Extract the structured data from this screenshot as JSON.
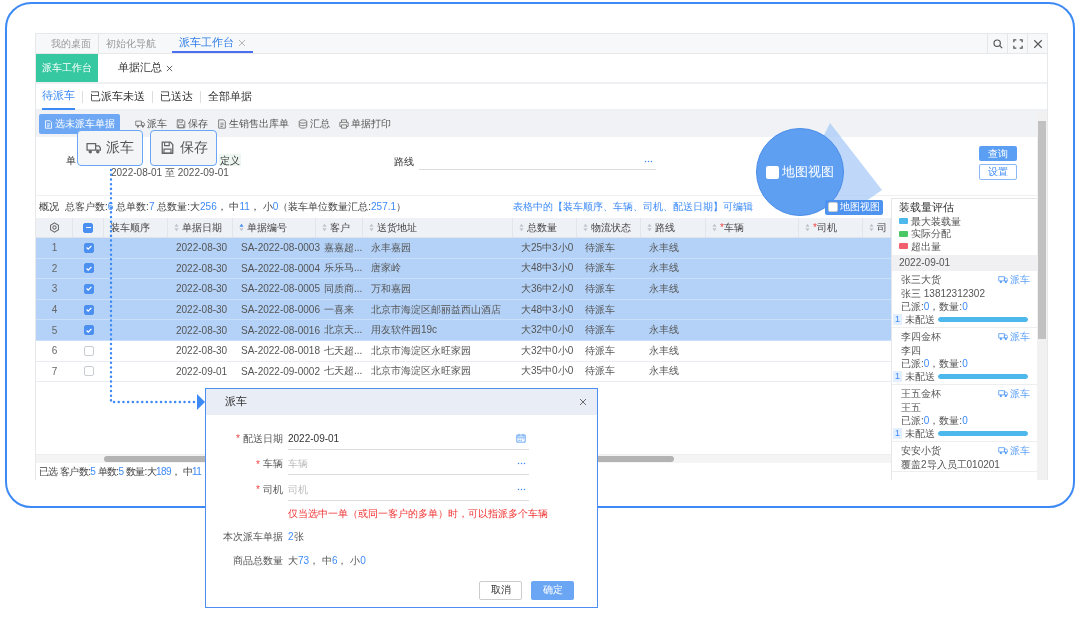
{
  "window": {
    "tabs": [
      {
        "label": "我的桌面",
        "selected": false,
        "closable": false
      },
      {
        "label": "初始化导航",
        "selected": false,
        "closable": false
      },
      {
        "label": "派车工作台",
        "selected": true,
        "closable": true
      }
    ]
  },
  "module_tabs": [
    {
      "label": "派车工作台",
      "selected": true,
      "closable": false
    },
    {
      "label": "单据汇总",
      "selected": false,
      "closable": true
    }
  ],
  "status_tabs": [
    {
      "label": "待派车",
      "selected": true
    },
    {
      "label": "已派车未送",
      "selected": false
    },
    {
      "label": "已送达",
      "selected": false
    },
    {
      "label": "全部单据",
      "selected": false
    }
  ],
  "toolbar": {
    "primary": "选未派车单据",
    "actions": [
      {
        "label": "派车",
        "kind": "truck"
      },
      {
        "label": "保存",
        "kind": "save"
      },
      {
        "label": "生销售出库单",
        "kind": "doc"
      },
      {
        "label": "汇总",
        "kind": "sum"
      },
      {
        "label": "单据打印",
        "kind": "print"
      }
    ]
  },
  "filters": {
    "date_label": "单",
    "range_options": [
      "定义"
    ],
    "date_range": "2022-08-01 至 2022-09-01",
    "route_label": "路线",
    "query": "查询",
    "settings": "设置"
  },
  "summary": {
    "title": "概况",
    "parts": [
      {
        "text": "总客户数:",
        "kind": "label"
      },
      {
        "text": "6",
        "kind": "number"
      },
      {
        "text": " 总单数:",
        "kind": "label"
      },
      {
        "text": "7",
        "kind": "number"
      },
      {
        "text": " 总数量:大",
        "kind": "label"
      },
      {
        "text": "256",
        "kind": "number"
      },
      {
        "text": "， 中",
        "kind": "label"
      },
      {
        "text": "11",
        "kind": "number"
      },
      {
        "text": "， 小",
        "kind": "label"
      },
      {
        "text": "0",
        "kind": "number"
      },
      {
        "text": "（装车单位数量汇总:",
        "kind": "label"
      },
      {
        "text": "257.1",
        "kind": "number"
      },
      {
        "text": "）",
        "kind": "label"
      }
    ]
  },
  "hint": "表格中的【装车顺序、车辆、司机、配送日期】可编辑",
  "map_view": {
    "label": "地图视图",
    "checked": false
  },
  "table": {
    "columns": [
      {
        "kind": "settings"
      },
      {
        "kind": "select",
        "indeterminate": true
      },
      {
        "kind": "data",
        "label": "装车顺序"
      },
      {
        "kind": "data",
        "label": "单据日期",
        "sorted": false
      },
      {
        "kind": "data",
        "label": "单据编号",
        "sorted": true
      },
      {
        "kind": "data",
        "label": "客户",
        "sorted": false
      },
      {
        "kind": "data",
        "label": "送货地址",
        "sorted": false
      },
      {
        "kind": "data",
        "label": "总数量",
        "sorted": false
      },
      {
        "kind": "data",
        "label": "物流状态",
        "sorted": false
      },
      {
        "kind": "data",
        "label": "路线",
        "sorted": false
      },
      {
        "kind": "data",
        "label": "车辆",
        "sorted": false,
        "marker": "*"
      },
      {
        "kind": "data",
        "label": "司机",
        "sorted": false,
        "marker": "*"
      },
      {
        "kind": "data",
        "label": "司",
        "sorted": false
      }
    ],
    "rows": [
      {
        "checked": true,
        "selected": true,
        "cells": [
          "1",
          "",
          "",
          "2022-08-30",
          "SA-2022-08-0003",
          "嘉嘉超...",
          "永丰嘉园",
          "大25中3小0",
          "待派车",
          "永丰线"
        ]
      },
      {
        "checked": true,
        "selected": true,
        "cells": [
          "2",
          "",
          "",
          "2022-08-30",
          "SA-2022-08-0004",
          "乐乐马...",
          "唐家岭",
          "大48中3小0",
          "待派车",
          "永丰线"
        ]
      },
      {
        "checked": true,
        "selected": true,
        "cells": [
          "3",
          "",
          "",
          "2022-08-30",
          "SA-2022-08-0005",
          "同质商...",
          "万和嘉园",
          "大36中2小0",
          "待派车",
          "永丰线"
        ]
      },
      {
        "checked": true,
        "selected": true,
        "cells": [
          "4",
          "",
          "",
          "2022-08-30",
          "SA-2022-08-0006",
          "一喜来",
          "北京市海淀区邮丽益西山酒店",
          "大48中3小0",
          "待派车",
          ""
        ]
      },
      {
        "checked": true,
        "selected": true,
        "cells": [
          "5",
          "",
          "",
          "2022-08-30",
          "SA-2022-08-0016",
          "北京天...",
          "用友软件园19c",
          "大32中0小0",
          "待派车",
          "永丰线"
        ]
      },
      {
        "checked": false,
        "selected": false,
        "cells": [
          "6",
          "",
          "",
          "2022-08-30",
          "SA-2022-08-0018",
          "七天超...",
          "北京市海淀区永旺家园",
          "大32中0小0",
          "待派车",
          "永丰线"
        ]
      },
      {
        "checked": false,
        "selected": false,
        "cells": [
          "7",
          "",
          "",
          "2022-09-01",
          "SA-2022-09-0002",
          "七天超...",
          "北京市海淀区永旺家园",
          "大35中0小0",
          "待派车",
          "永丰线"
        ]
      }
    ]
  },
  "status_bar": {
    "parts": [
      {
        "text": "已选 客户数:",
        "kind": "label"
      },
      {
        "text": "5",
        "kind": "number"
      },
      {
        "text": " 单数:",
        "kind": "label"
      },
      {
        "text": "5",
        "kind": "number"
      },
      {
        "text": " 数量:大",
        "kind": "label"
      },
      {
        "text": "189",
        "kind": "number"
      },
      {
        "text": "， 中",
        "kind": "label"
      },
      {
        "text": "11",
        "kind": "number"
      }
    ]
  },
  "load_panel": {
    "title": "装载量评估",
    "legend": [
      {
        "label": "最大装载量",
        "color": "#4db8ec"
      },
      {
        "label": "实际分配",
        "color": "#4cc765"
      },
      {
        "label": "超出量",
        "color": "#f0616d"
      }
    ],
    "date": "2022-09-01",
    "cards": [
      {
        "name": "张三大货",
        "contact": "张三  13812312302",
        "action": "派车",
        "stats": [
          {
            "text": "已派:",
            "kind": "label"
          },
          {
            "text": "0",
            "kind": "number"
          },
          {
            "text": "，数量:",
            "kind": "label"
          },
          {
            "text": "0",
            "kind": "number"
          }
        ],
        "badge": "1",
        "status": "未配送",
        "level": 1
      },
      {
        "name": "李四金杯",
        "contact": "李四",
        "action": "派车",
        "stats": [
          {
            "text": "已派:",
            "kind": "label"
          },
          {
            "text": "0",
            "kind": "number"
          },
          {
            "text": "，数量:",
            "kind": "label"
          },
          {
            "text": "0",
            "kind": "number"
          }
        ],
        "badge": "1",
        "status": "未配送",
        "level": 1
      },
      {
        "name": "王五金杯",
        "contact": "王五",
        "action": "派车",
        "stats": [
          {
            "text": "已派:",
            "kind": "label"
          },
          {
            "text": "0",
            "kind": "number"
          },
          {
            "text": "，数量:",
            "kind": "label"
          },
          {
            "text": "0",
            "kind": "number"
          }
        ],
        "badge": "1",
        "status": "未配送",
        "level": 1
      },
      {
        "name": "安安小货",
        "contact": "覆盖2导入员工010201",
        "action": "派车"
      }
    ]
  },
  "callouts": [
    {
      "label": "派车",
      "kind": "truck"
    },
    {
      "label": "保存",
      "kind": "save"
    }
  ],
  "map_callout": {
    "label": "地图视图"
  },
  "dialog": {
    "title": "派车",
    "fields": [
      {
        "label": "配送日期",
        "marker": "*",
        "kind": "date",
        "value": "2022-09-01"
      },
      {
        "label": "车辆",
        "marker": "*",
        "kind": "picker",
        "placeholder": "车辆"
      },
      {
        "label": "司机",
        "marker": "*",
        "kind": "picker",
        "placeholder": "司机"
      }
    ],
    "note": "仅当选中一单（或同一客户的多单）时，可以指派多个车辆",
    "info": [
      {
        "label": "本次派车单据",
        "parts": [
          {
            "text": "2",
            "kind": "number"
          },
          {
            "text": "张",
            "kind": "label"
          }
        ]
      },
      {
        "label": "商品总数量",
        "parts": [
          {
            "text": "大",
            "kind": "label"
          },
          {
            "text": "73",
            "kind": "number"
          },
          {
            "text": "， 中",
            "kind": "label"
          },
          {
            "text": "6",
            "kind": "number"
          },
          {
            "text": "， 小",
            "kind": "label"
          },
          {
            "text": "0",
            "kind": "number"
          }
        ]
      }
    ],
    "buttons": [
      {
        "label": "取消",
        "kind": "secondary"
      },
      {
        "label": "确定",
        "kind": "primary"
      }
    ]
  }
}
